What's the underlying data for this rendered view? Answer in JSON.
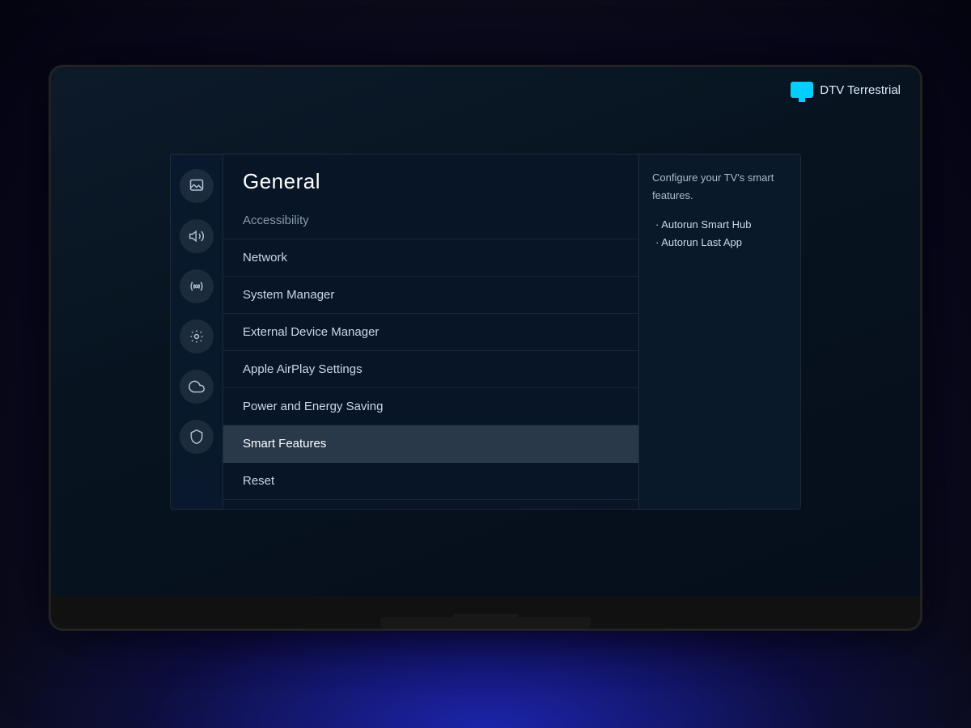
{
  "tv": {
    "badge": {
      "icon_label": "dtv-icon",
      "text": "DTV Terrestrial"
    }
  },
  "settings": {
    "title": "General",
    "sidebar_icons": [
      {
        "name": "picture-icon",
        "symbol": "🖼"
      },
      {
        "name": "sound-icon",
        "symbol": "🔊"
      },
      {
        "name": "broadcast-icon",
        "symbol": "📡"
      },
      {
        "name": "general-icon",
        "symbol": "🔧"
      },
      {
        "name": "smarttv-icon",
        "symbol": "☁"
      },
      {
        "name": "security-icon",
        "symbol": "🔒"
      }
    ],
    "menu_items": [
      {
        "label": "Accessibility",
        "state": "normal"
      },
      {
        "label": "Network",
        "state": "normal"
      },
      {
        "label": "System Manager",
        "state": "normal"
      },
      {
        "label": "External Device Manager",
        "state": "normal"
      },
      {
        "label": "Apple AirPlay Settings",
        "state": "normal"
      },
      {
        "label": "Power and Energy Saving",
        "state": "normal"
      },
      {
        "label": "Smart Features",
        "state": "active"
      },
      {
        "label": "Reset",
        "state": "normal"
      }
    ],
    "side_info": {
      "description": "Configure your TV's smart features.",
      "bullets": [
        "· Autorun Smart Hub",
        "· Autorun Last App"
      ]
    }
  }
}
